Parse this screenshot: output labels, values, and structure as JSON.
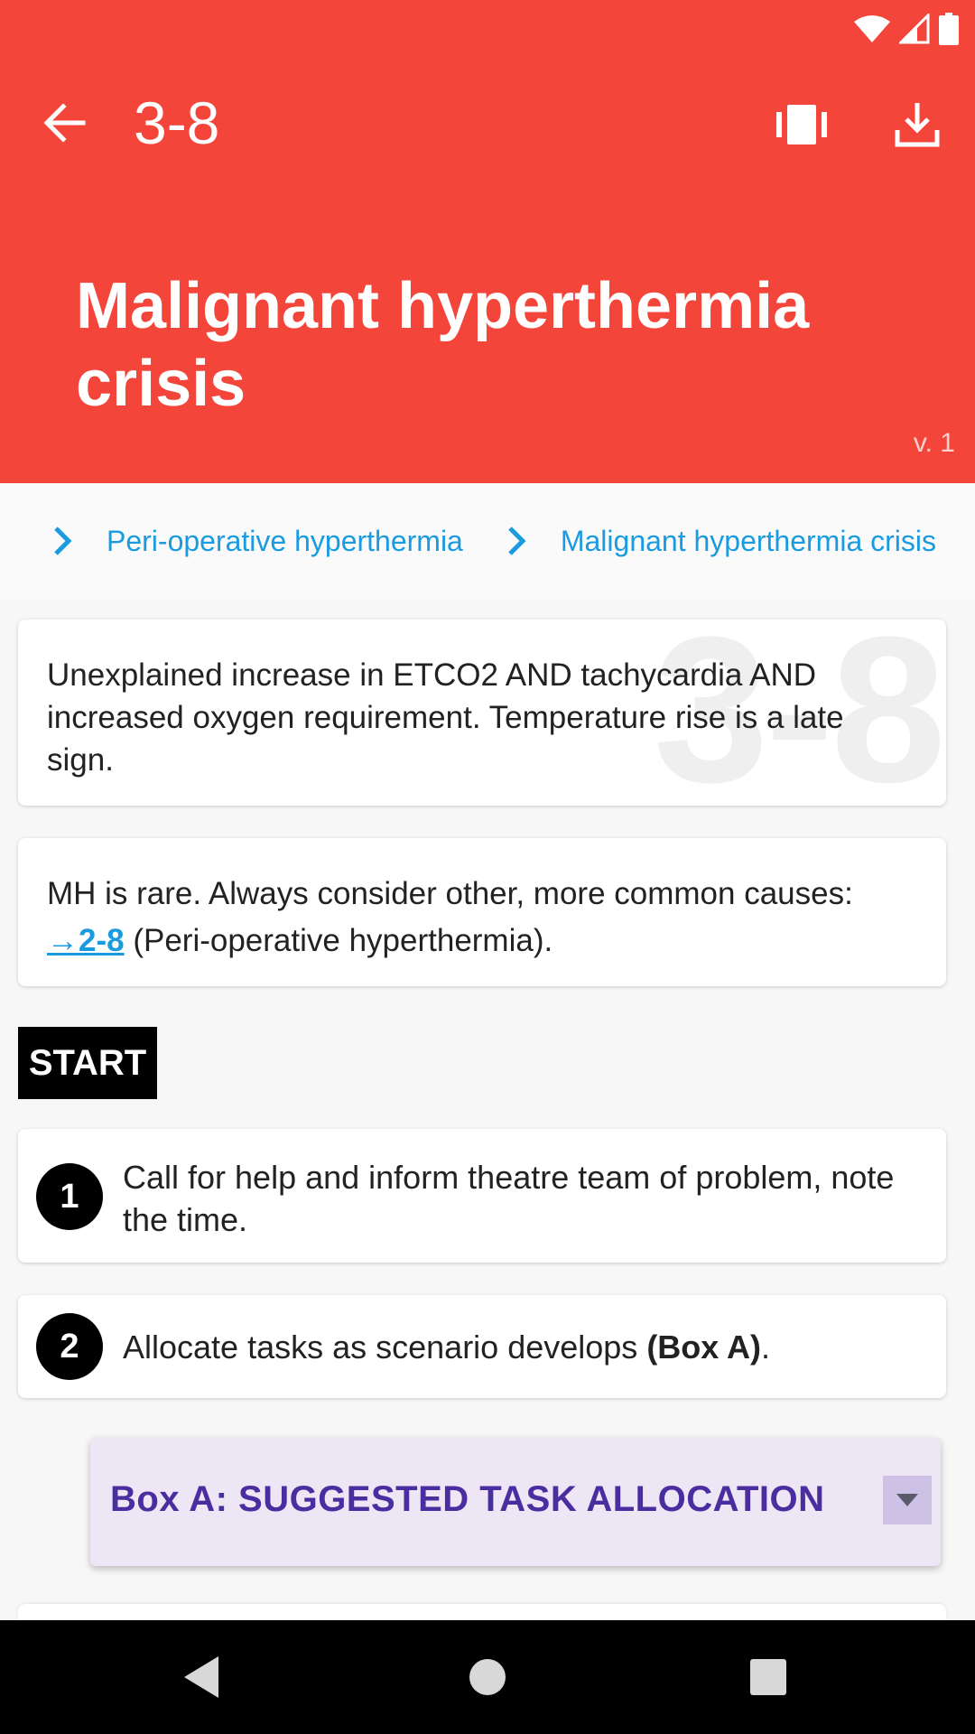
{
  "statusbar": {
    "icons": [
      "wifi-icon",
      "cell-signal-icon",
      "battery-icon"
    ]
  },
  "toolbar": {
    "code": "3-8",
    "actions": [
      "view-carousel-icon",
      "download-icon"
    ]
  },
  "header": {
    "title": "Malignant hyperthermia crisis",
    "version": "v. 1",
    "color": "#f4453b"
  },
  "breadcrumb": {
    "items": [
      {
        "label": "Peri-operative hyperthermia"
      },
      {
        "label": "Malignant hyperthermia crisis"
      }
    ]
  },
  "cards": {
    "watermark": "3-8",
    "summary": "Unexplained increase in ETCO2 AND tachycardia AND increased oxygen requirement. Temperature rise is a late sign.",
    "note_prefix": "MH is rare. Always consider other, more common causes: ",
    "note_link": "→2-8",
    "note_suffix": " (Peri-operative hyperthermia)."
  },
  "start_label": "START",
  "steps": [
    {
      "number": "1",
      "text": "Call for help and inform theatre team of problem, note the time."
    },
    {
      "number": "2",
      "text_prefix": "Allocate tasks as scenario develops ",
      "text_bold": "(Box A)",
      "text_suffix": "."
    }
  ],
  "box_a": {
    "title": "Box A: SUGGESTED TASK ALLOCATION",
    "accent": "#4a2ea0"
  },
  "navbar": {
    "buttons": [
      "back-triangle-icon",
      "home-circle-icon",
      "recents-square-icon"
    ]
  }
}
